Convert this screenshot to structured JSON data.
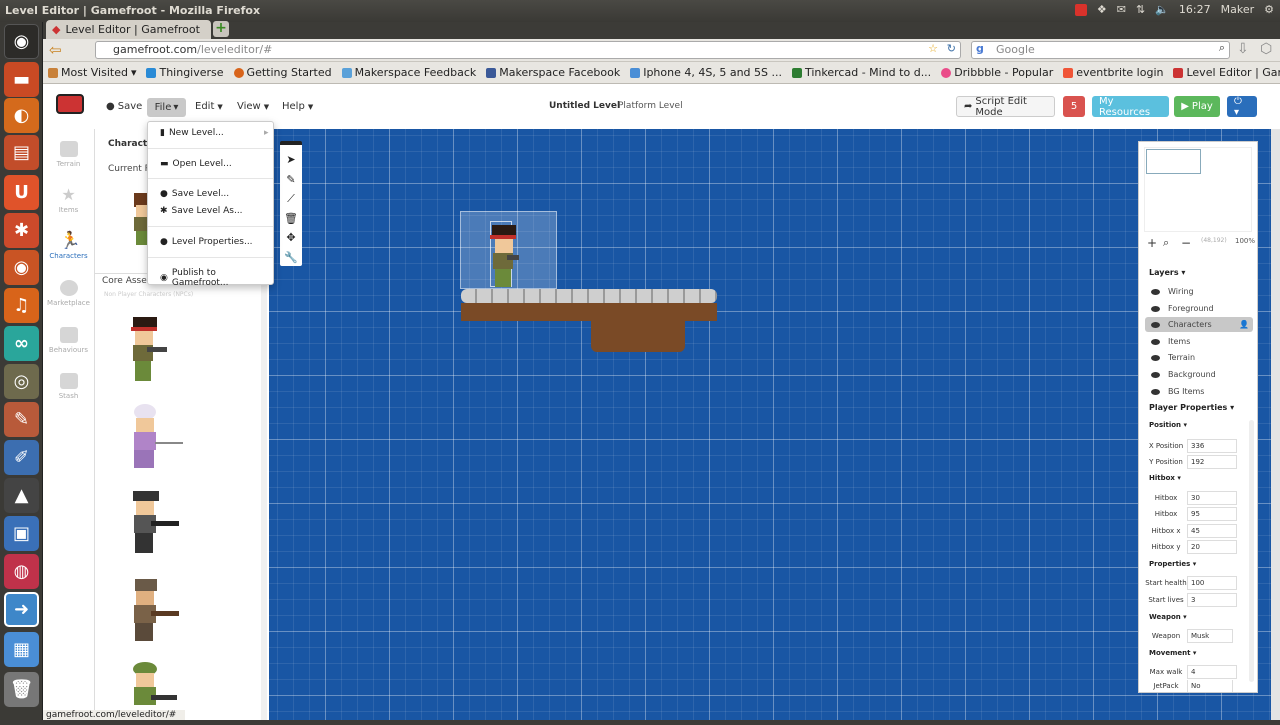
{
  "os": {
    "window_title": "Level Editor | Gamefroot - Mozilla Firefox",
    "time": "16:27",
    "user": "Maker"
  },
  "browser": {
    "tab_title": "Level Editor | Gamefroot",
    "url_host": "gamefroot.com",
    "url_path": "/leveleditor/#",
    "search_placeholder": "Google",
    "bookmarks": [
      "Most Visited",
      "Thingiverse",
      "Getting Started",
      "Makerspace Feedback",
      "Makerspace Facebook",
      "Iphone 4, 4S, 5 and 5S ...",
      "Tinkercad - Mind to d...",
      "Dribbble - Popular",
      "eventbrite login",
      "Level Editor | Gamefr..."
    ],
    "status_url": "gamefroot.com/leveleditor/#"
  },
  "toolbar": {
    "save": "Save",
    "file": "File",
    "edit": "Edit",
    "view": "View",
    "help": "Help",
    "level_name": "Untitled Level",
    "level_type": "Platform Level",
    "script_mode": "Script Edit Mode",
    "count": "5",
    "resources": "My Resources",
    "play": "Play"
  },
  "file_menu": {
    "items": [
      "New Level...",
      "Open Level...",
      "Save Level...",
      "Save Level As...",
      "Level Properties...",
      "Publish to Gamefroot..."
    ]
  },
  "leftnav": [
    "Terrain",
    "Items",
    "Characters",
    "Marketplace",
    "Behaviours",
    "Stash"
  ],
  "char_panel": {
    "title": "Character",
    "current": "Current Pla",
    "core": "Core Assets",
    "npc": "Non Player Characters (NPCs)"
  },
  "minimap": {
    "coords": "(48,192)",
    "zoom": "100%"
  },
  "layers": {
    "title": "Layers",
    "items": [
      "Wiring",
      "Foreground",
      "Characters",
      "Items",
      "Terrain",
      "Background",
      "BG Items"
    ]
  },
  "props": {
    "title": "Player Properties",
    "position": {
      "title": "Position",
      "x_label": "X Position",
      "x": "336",
      "y_label": "Y Position",
      "y": "192"
    },
    "hitbox": {
      "title": "Hitbox",
      "rows": [
        {
          "l": "Hitbox",
          "v": "30"
        },
        {
          "l": "Hitbox",
          "v": "95"
        },
        {
          "l": "Hitbox x",
          "v": "45"
        },
        {
          "l": "Hitbox y",
          "v": "20"
        }
      ]
    },
    "properties": {
      "title": "Properties",
      "health_label": "Start health",
      "health": "100",
      "lives_label": "Start lives",
      "lives": "3"
    },
    "weapon": {
      "title": "Weapon",
      "label": "Weapon",
      "value": "Musk"
    },
    "movement": {
      "title": "Movement",
      "walk_label": "Max walk",
      "walk": "4",
      "jet_label": "JetPack",
      "jet": "No"
    }
  }
}
